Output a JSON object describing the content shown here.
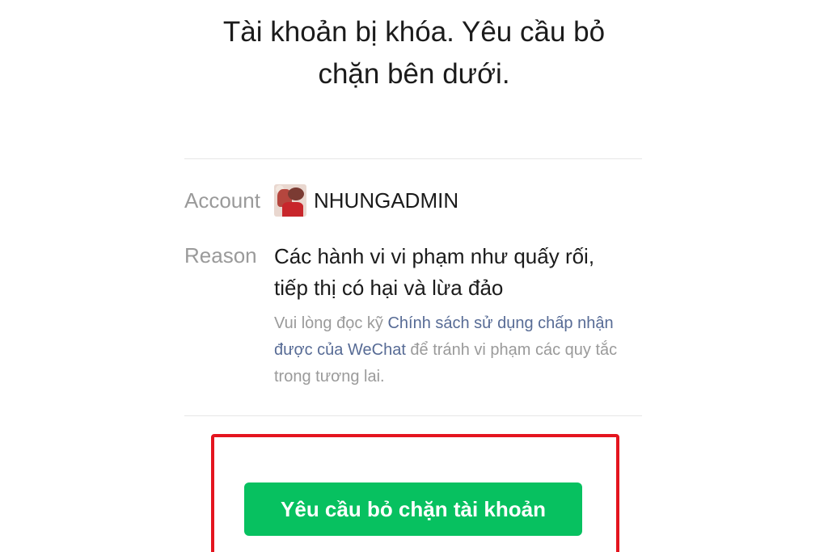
{
  "header": {
    "title_line1": "Tài khoản bị khóa. Yêu cầu bỏ",
    "title_line2": "chặn bên dưới."
  },
  "account": {
    "label": "Account",
    "name": "NHUNGADMIN"
  },
  "reason": {
    "label": "Reason",
    "text_line1": "Các hành vi vi phạm như quấy rối,",
    "text_line2": "tiếp thị có hại và lừa đảo"
  },
  "note": {
    "prefix": "Vui lòng đọc kỹ ",
    "link": "Chính sách sử dụng chấp nhận được của WeChat",
    "suffix": " để tránh vi phạm các quy tắc trong tương lai."
  },
  "actions": {
    "unblock_label": "Yêu cầu bỏ chặn tài khoản"
  },
  "colors": {
    "primary_button": "#07c160",
    "link": "#576b95",
    "highlight_border": "#e4151f"
  }
}
